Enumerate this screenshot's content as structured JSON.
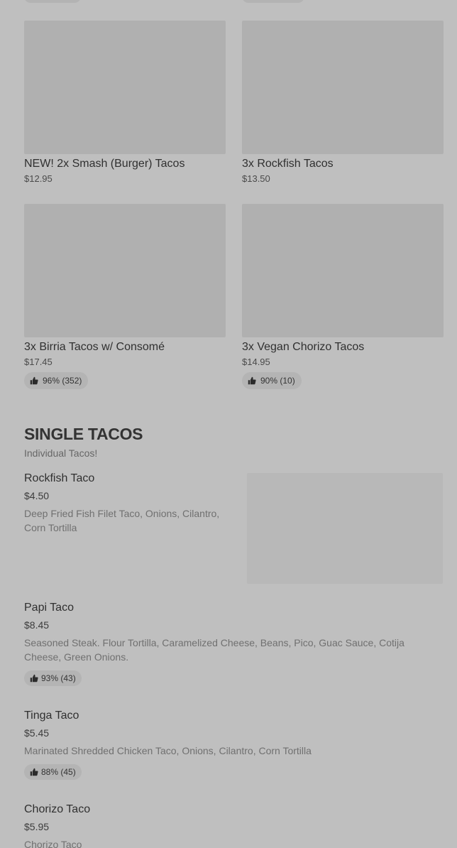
{
  "grid_items": [
    {
      "name": "NEW! 2x Smash (Burger) Tacos",
      "price": "$12.95"
    },
    {
      "name": "3x Rockfish Tacos",
      "price": "$13.50"
    },
    {
      "name": "3x Birria Tacos w/ Consomé",
      "price": "$17.45",
      "rating": "96% (352)"
    },
    {
      "name": "3x Vegan Chorizo Tacos",
      "price": "$14.95",
      "rating": "90% (10)"
    }
  ],
  "section": {
    "title": "SINGLE TACOS",
    "subtitle": "Individual Tacos!"
  },
  "list_items": [
    {
      "name": "Rockfish Taco",
      "price": "$4.50",
      "description": "Deep Fried Fish Filet Taco, Onions, Cilantro, Corn Tortilla"
    },
    {
      "name": "Papi Taco",
      "price": "$8.45",
      "description": "Seasoned Steak. Flour Tortilla, Caramelized Cheese, Beans, Pico, Guac Sauce, Cotija Cheese, Green Onions.",
      "rating": "93% (43)"
    },
    {
      "name": "Tinga Taco",
      "price": "$5.45",
      "description": "Marinated Shredded Chicken Taco, Onions, Cilantro, Corn Tortilla",
      "rating": "88% (45)"
    },
    {
      "name": "Chorizo Taco",
      "price": "$5.95",
      "description": "Chorizo Taco"
    }
  ],
  "icons": {
    "rating": "thumbs-up-icon"
  },
  "colors": {
    "background": "#bfbfbf",
    "image_placeholder": "#b0b0b0",
    "pill": "#b4b4b4"
  }
}
